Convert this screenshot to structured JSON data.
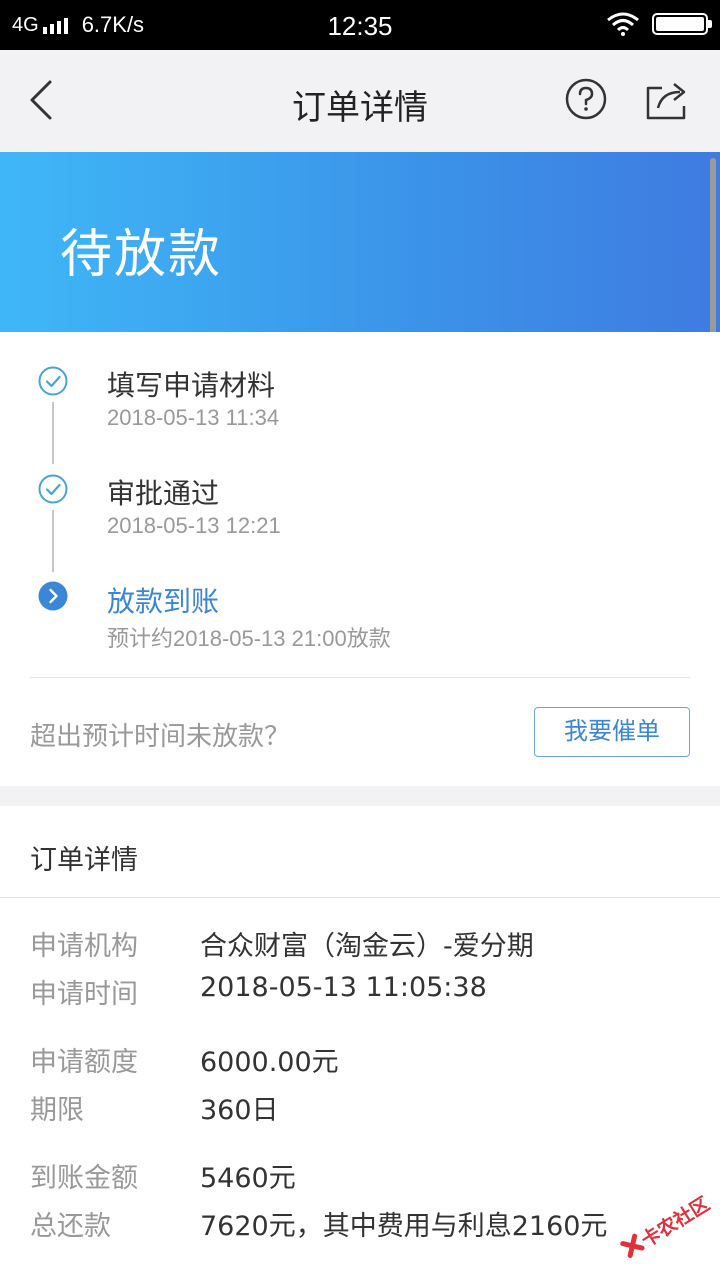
{
  "status_bar": {
    "network": "4G",
    "speed": "6.7K/s",
    "time": "12:35",
    "icons": [
      "signal-icon",
      "wifi-icon",
      "battery-icon"
    ]
  },
  "nav": {
    "title": "订单详情",
    "icons": [
      "back-icon",
      "help-icon",
      "share-icon"
    ]
  },
  "hero": {
    "status": "待放款",
    "gradient_colors": [
      "#3fb7f7",
      "#3f7be1"
    ]
  },
  "timeline": {
    "steps": [
      {
        "title": "填写申请材料",
        "time": "2018-05-13 11:34",
        "state": "done"
      },
      {
        "title": "审批通过",
        "time": "2018-05-13 12:21",
        "state": "done"
      },
      {
        "title": "放款到账",
        "time": "预计约2018-05-13 21:00放款",
        "state": "current"
      }
    ]
  },
  "urge": {
    "question": "超出预计时间未放款？",
    "button_label": "我要催单"
  },
  "details": {
    "title": "订单详情",
    "rows": [
      {
        "label": "申请机构",
        "value": "合众财富（淘金云）-爱分期"
      },
      {
        "label": "申请时间",
        "value": "2018-05-13 11:05:38"
      },
      {
        "label": "申请额度",
        "value": "6000.00元"
      },
      {
        "label": "期限",
        "value": "360日"
      },
      {
        "label": "到账金额",
        "value": "5460元"
      },
      {
        "label": "总还款",
        "value": "7620元，其中费用与利息2160元"
      }
    ]
  },
  "watermark": {
    "text": "卡农社区"
  },
  "colors": {
    "accent": "#3b86d6",
    "done_icon": "#4aa3d8",
    "muted_text": "#999999"
  }
}
